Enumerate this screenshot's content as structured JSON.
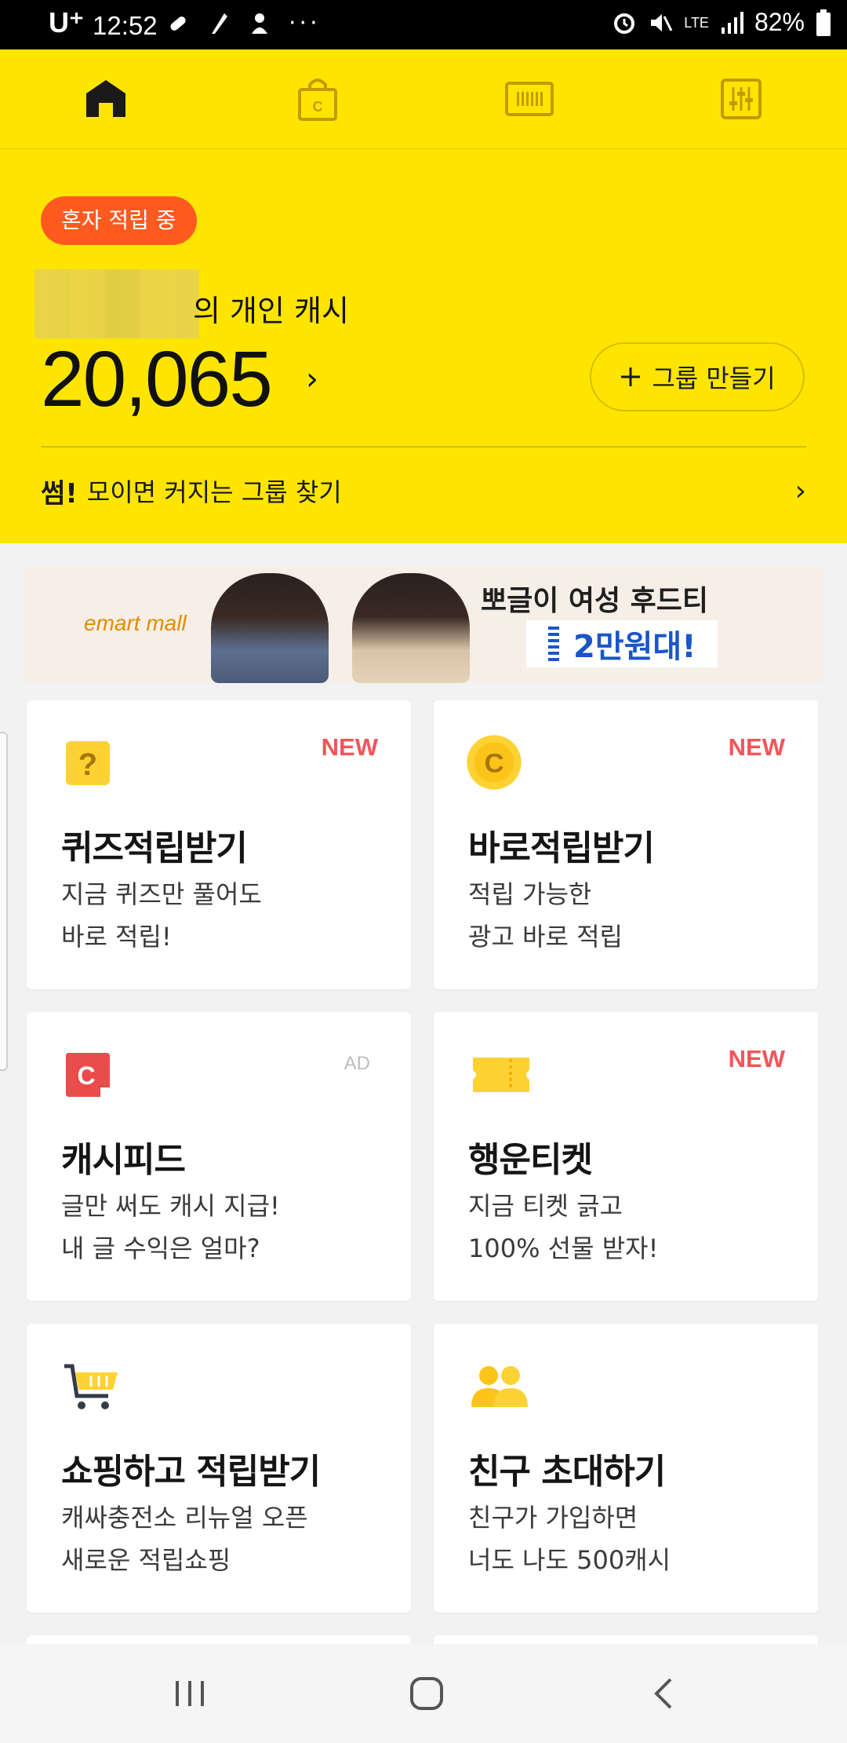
{
  "status_bar": {
    "carrier": "U⁺",
    "time": "12:52",
    "network": "LTE",
    "battery": "82%"
  },
  "top_nav": {
    "tabs": [
      {
        "icon": "home-icon",
        "active": true
      },
      {
        "icon": "shopping-bag-icon",
        "active": false
      },
      {
        "icon": "barcode-icon",
        "active": false
      },
      {
        "icon": "settings-sliders-icon",
        "active": false
      }
    ]
  },
  "header": {
    "badge": "혼자 적립 중",
    "cash_label": "의 개인 캐시",
    "cash_amount": "20,065",
    "create_group_label": "그룹 만들기",
    "find_group_prefix": "썸!",
    "find_group_text": "모이면 커지는 그룹 찾기"
  },
  "banner": {
    "brand": "emart mall",
    "headline": "뽀글이 여성 후드티",
    "price": "2만원대!"
  },
  "cards": [
    {
      "title": "퀴즈적립받기",
      "desc1": "지금 퀴즈만 풀어도",
      "desc2": "바로 적립!",
      "tag": "NEW",
      "icon": "quiz-icon"
    },
    {
      "title": "바로적립받기",
      "desc1": "적립 가능한",
      "desc2": "광고 바로 적립",
      "tag": "NEW",
      "icon": "coin-icon"
    },
    {
      "title": "캐시피드",
      "desc1": "글만 써도 캐시 지급!",
      "desc2": "내 글 수익은 얼마?",
      "tag": "AD",
      "icon": "cashfeed-icon"
    },
    {
      "title": "행운티켓",
      "desc1": "지금 티켓 긁고",
      "desc2": "100% 선물 받자!",
      "tag": "NEW",
      "icon": "ticket-icon"
    },
    {
      "title": "쇼핑하고 적립받기",
      "desc1": "캐싸충전소 리뉴얼 오픈",
      "desc2": "새로운 적립쇼핑",
      "tag": "",
      "icon": "cart-icon"
    },
    {
      "title": "친구 초대하기",
      "desc1": "친구가 가입하면",
      "desc2": "너도 나도 500캐시",
      "tag": "",
      "icon": "friends-icon"
    }
  ],
  "colors": {
    "brand_yellow": "#fee500",
    "badge_orange": "#ff5a1f",
    "new_red": "#f2555a",
    "price_blue": "#1a56c8"
  }
}
